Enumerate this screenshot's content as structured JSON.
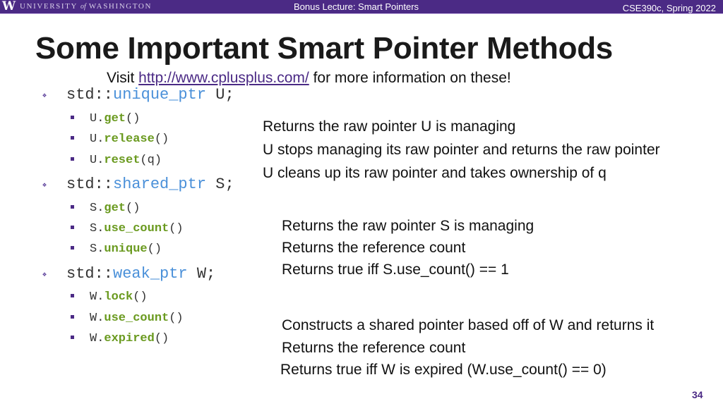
{
  "header": {
    "logo_letter": "W",
    "university_pre": "UNIVERSITY",
    "university_of": "of",
    "university_post": "WASHINGTON",
    "lecture": "Bonus Lecture: Smart Pointers",
    "course": "CSE390c, Spring 2022"
  },
  "slide": {
    "title": "Some Important Smart Pointer Methods",
    "subtitle_pre": "Visit ",
    "subtitle_link": "http://www.cplusplus.com/",
    "subtitle_post": " for more information on these!",
    "page_number": "34"
  },
  "groups": [
    {
      "prefix": "std::",
      "type": "unique_ptr",
      "var": " U;",
      "methods": [
        {
          "obj": "U.",
          "name": "get",
          "args": "()",
          "desc": "Returns the raw pointer U is managing"
        },
        {
          "obj": "U.",
          "name": "release",
          "args": "()",
          "desc": "U stops managing its raw pointer and returns the raw pointer"
        },
        {
          "obj": "U.",
          "name": "reset",
          "args": "(q)",
          "desc": "U cleans up its raw pointer and takes ownership of q"
        }
      ]
    },
    {
      "prefix": "std::",
      "type": "shared_ptr",
      "var": " S;",
      "methods": [
        {
          "obj": "S.",
          "name": "get",
          "args": "()",
          "desc": "Returns the raw pointer S is managing"
        },
        {
          "obj": "S.",
          "name": "use_count",
          "args": "()",
          "desc": "Returns the reference count"
        },
        {
          "obj": "S.",
          "name": "unique",
          "args": "()",
          "desc": "Returns true iff S.use_count() == 1"
        }
      ]
    },
    {
      "prefix": "std::",
      "type": "weak_ptr",
      "var": " W;",
      "methods": [
        {
          "obj": "W.",
          "name": "lock",
          "args": "()",
          "desc": "Constructs a shared pointer based off of W and returns it"
        },
        {
          "obj": "W.",
          "name": "use_count",
          "args": "()",
          "desc": "Returns the reference count"
        },
        {
          "obj": "W.",
          "name": "expired",
          "args": "()",
          "desc": "Returns true iff W is expired (W.use_count() == 0)"
        }
      ]
    }
  ]
}
